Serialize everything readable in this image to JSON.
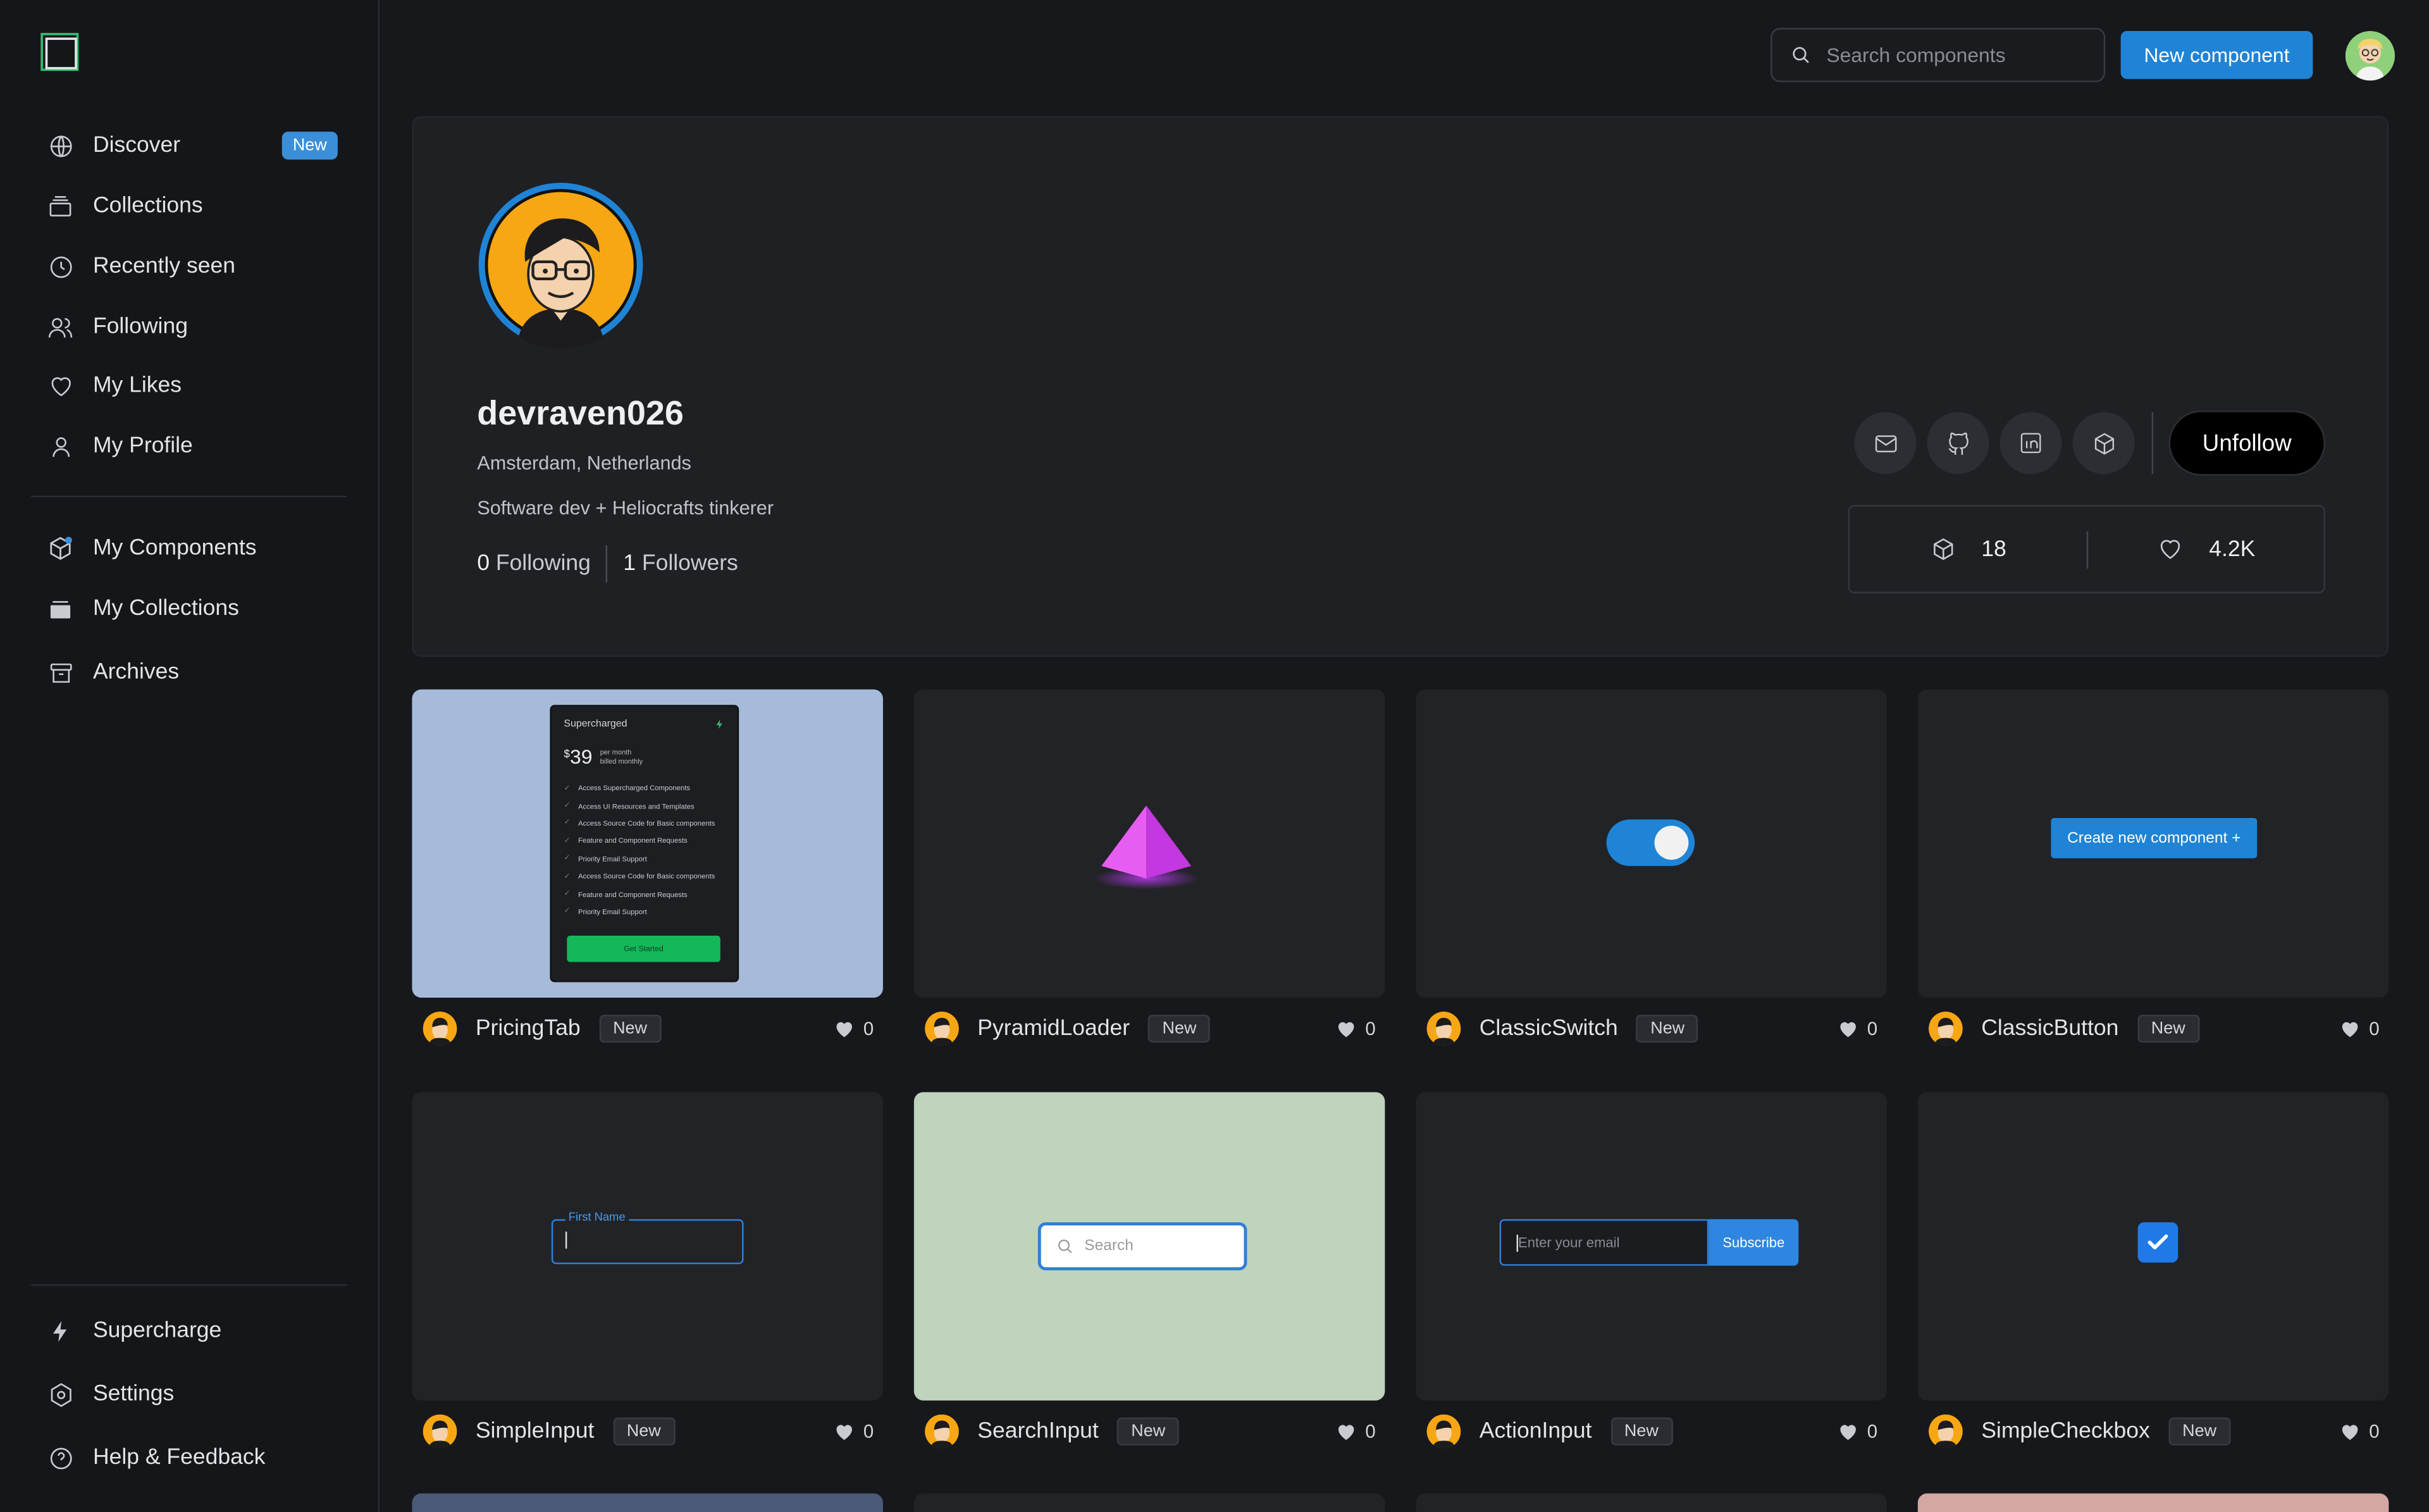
{
  "sidebar": {
    "nav": [
      {
        "label": "Discover",
        "icon": "globe-icon",
        "badge": "New"
      },
      {
        "label": "Collections",
        "icon": "collections-icon"
      },
      {
        "label": "Recently seen",
        "icon": "clock-icon"
      },
      {
        "label": "Following",
        "icon": "users-icon"
      },
      {
        "label": "My Likes",
        "icon": "heart-icon"
      },
      {
        "label": "My Profile",
        "icon": "user-icon"
      }
    ],
    "nav2": [
      {
        "label": "My Components",
        "icon": "cube-icon"
      },
      {
        "label": "My Collections",
        "icon": "folder-icon"
      },
      {
        "label": "Archives",
        "icon": "archive-icon"
      }
    ],
    "footer": [
      {
        "label": "Supercharge",
        "icon": "bolt-icon"
      },
      {
        "label": "Settings",
        "icon": "settings-icon"
      },
      {
        "label": "Help & Feedback",
        "icon": "help-icon"
      }
    ]
  },
  "topbar": {
    "search_placeholder": "Search components",
    "new_component_label": "New component"
  },
  "profile": {
    "username": "devraven026",
    "location": "Amsterdam, Netherlands",
    "bio": "Software dev + Heliocrafts tinkerer",
    "following_count": "0",
    "following_label": "Following",
    "followers_count": "1",
    "followers_label": "Followers",
    "unfollow_label": "Unfollow",
    "components_count": "18",
    "likes_count": "4.2K"
  },
  "components": [
    {
      "title": "PricingTab",
      "tag": "New",
      "likes": "0"
    },
    {
      "title": "PyramidLoader",
      "tag": "New",
      "likes": "0"
    },
    {
      "title": "ClassicSwitch",
      "tag": "New",
      "likes": "0"
    },
    {
      "title": "ClassicButton",
      "tag": "New",
      "likes": "0"
    },
    {
      "title": "SimpleInput",
      "tag": "New",
      "likes": "0"
    },
    {
      "title": "SearchInput",
      "tag": "New",
      "likes": "0"
    },
    {
      "title": "ActionInput",
      "tag": "New",
      "likes": "0"
    },
    {
      "title": "SimpleCheckbox",
      "tag": "New",
      "likes": "0"
    }
  ],
  "previews": {
    "pricing": {
      "title": "Supercharged",
      "currency": "$",
      "price": "39",
      "per": "per month",
      "billed": "billed monthly",
      "features": [
        "Access Supercharged Components",
        "Access UI Resources and Templates",
        "Access Source Code for Basic components",
        "Feature and Component Requests",
        "Priority Email Support",
        "Access Source Code for Basic components",
        "Feature and Component Requests",
        "Priority Email Support"
      ],
      "cta": "Get Started"
    },
    "classic_button": "Create new component +",
    "simple_input_label": "First Name",
    "search_input_placeholder": "Search",
    "action_input_placeholder": "Enter your email",
    "action_input_button": "Subscribe"
  }
}
